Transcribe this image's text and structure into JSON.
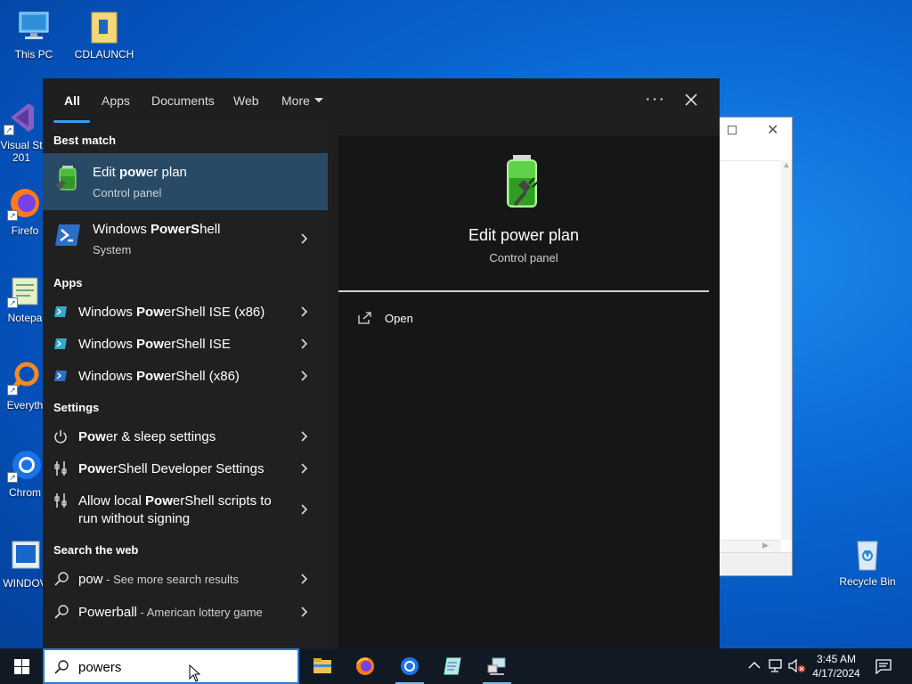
{
  "desktop": {
    "icons": [
      {
        "label": "This PC"
      },
      {
        "label": "CDLAUNCH"
      },
      {
        "label": "Visual St 201"
      },
      {
        "label": "Firefo"
      },
      {
        "label": "Notepa"
      },
      {
        "label": "Everyth"
      },
      {
        "label": "Chrom"
      },
      {
        "label": "WINDOV"
      },
      {
        "label": "Recycle Bin"
      }
    ]
  },
  "search": {
    "tabs": [
      {
        "label": "All"
      },
      {
        "label": "Apps"
      },
      {
        "label": "Documents"
      },
      {
        "label": "Web"
      },
      {
        "label": "More"
      }
    ],
    "more_icon": "ellipsis-icon",
    "close_icon": "close-icon",
    "sections": {
      "best_match": "Best match",
      "apps": "Apps",
      "settings": "Settings",
      "web": "Search the web"
    },
    "best_match": [
      {
        "pre": "Edit ",
        "hl": "pow",
        "post": "er plan",
        "sub": "Control panel",
        "icon": "battery-plug-icon"
      },
      {
        "pre": "Windows ",
        "hl": "PowerS",
        "post": "hell",
        "sub": "System",
        "icon": "powershell-icon"
      }
    ],
    "apps": [
      {
        "pre": "Windows ",
        "hl": "Pow",
        "post": "erShell ISE (x86)",
        "icon": "powershell-ise-icon"
      },
      {
        "pre": "Windows ",
        "hl": "Pow",
        "post": "erShell ISE",
        "icon": "powershell-ise-icon"
      },
      {
        "pre": "Windows ",
        "hl": "Pow",
        "post": "erShell (x86)",
        "icon": "powershell-icon"
      }
    ],
    "settings": [
      {
        "pre": "",
        "hl": "Pow",
        "post": "er & sleep settings",
        "icon": "power-icon"
      },
      {
        "pre": "",
        "hl": "Pow",
        "post": "erShell Developer Settings",
        "icon": "developer-settings-icon"
      },
      {
        "pre": "Allow local ",
        "hl": "Pow",
        "post": "erShell scripts to",
        "line2": "run without signing",
        "icon": "developer-settings-icon"
      }
    ],
    "web": [
      {
        "term": "pow",
        "desc": " - See more search results",
        "icon": "search-icon"
      },
      {
        "term": "Powerball",
        "desc": " - American lottery game",
        "icon": "search-icon"
      }
    ],
    "preview": {
      "title": "Edit power plan",
      "subtitle": "Control panel",
      "icon": "battery-plug-icon",
      "actions": [
        {
          "label": "Open",
          "icon": "open-icon"
        }
      ]
    },
    "query": "powers"
  },
  "taskbar": {
    "apps": [
      {
        "name": "file-explorer-icon"
      },
      {
        "name": "firefox-icon"
      },
      {
        "name": "chrome-icon"
      },
      {
        "name": "notepad-icon"
      },
      {
        "name": "network-tool-icon"
      }
    ],
    "time": "3:45 AM",
    "date": "4/17/2024"
  },
  "colors": {
    "accent": "#3a9ef0",
    "selected_row": "#294a65",
    "panel_bg": "#1f1f1f",
    "preview_bg": "#161616"
  }
}
